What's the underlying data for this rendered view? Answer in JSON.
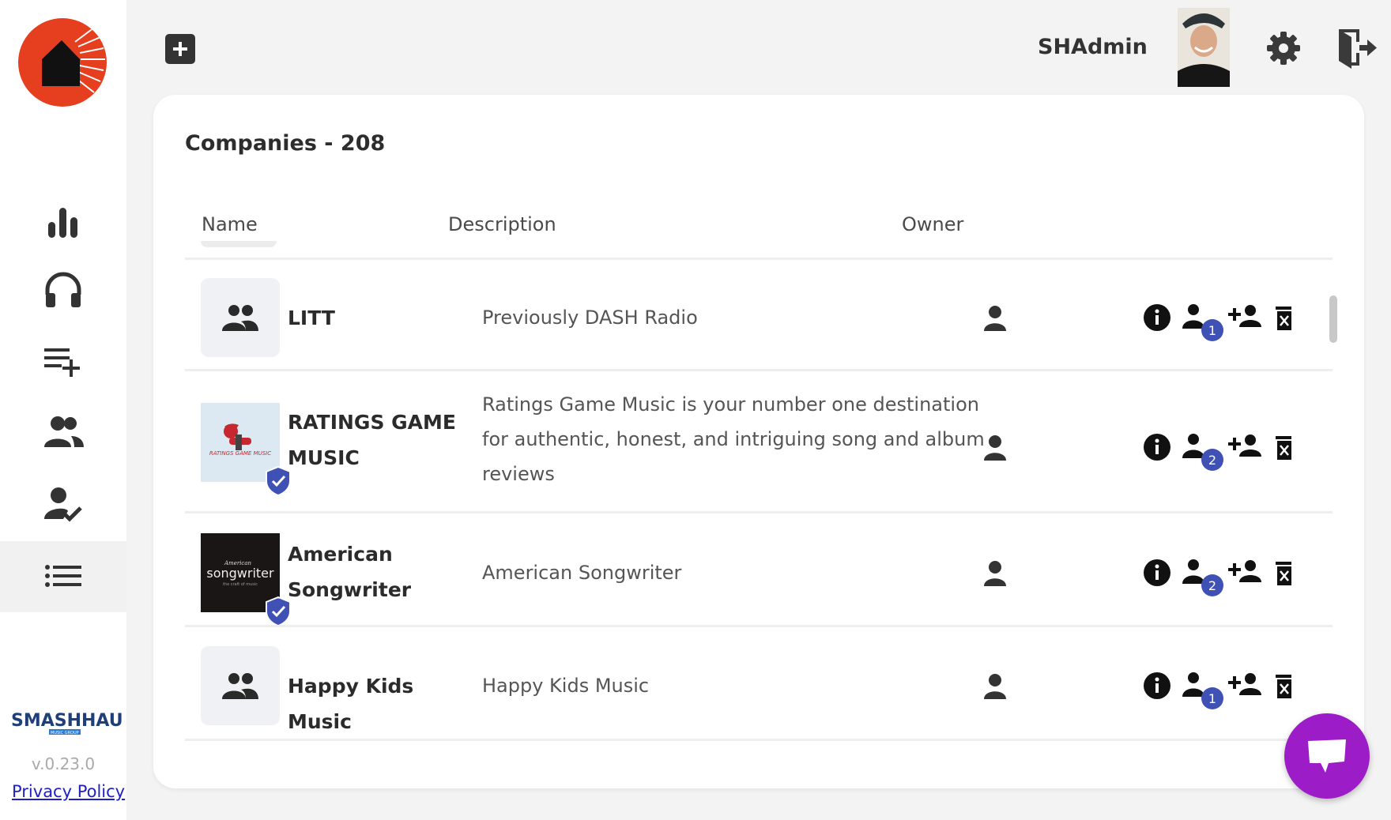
{
  "app": {
    "username": "SHAdmin",
    "version": "v.0.23.0",
    "privacy_label": "Privacy Policy",
    "brand_name": "SMASHHAUS",
    "brand_sub": "MUSIC GROUP"
  },
  "page": {
    "title": "Companies - 208"
  },
  "table": {
    "columns": {
      "name": "Name",
      "description": "Description",
      "owner": "Owner"
    },
    "rows": [
      {
        "name": "LITT",
        "description": "Previously DASH Radio",
        "members": "1",
        "verified": false
      },
      {
        "name": "RATINGS GAME MUSIC",
        "description": "Ratings Game Music is your number one destination for authentic, honest, and intriguing song and album reviews",
        "members": "2",
        "verified": true,
        "logo_text": "RATINGS GAME MUSIC"
      },
      {
        "name": "American Songwriter",
        "description": "American Songwriter",
        "members": "2",
        "verified": true,
        "logo_text": "songwriter",
        "logo_top": "American",
        "logo_sub": "the craft of music"
      },
      {
        "name": "Happy Kids Music",
        "description": "Happy Kids Music",
        "members": "1",
        "verified": false
      }
    ]
  },
  "colors": {
    "accent": "#3f51b5",
    "chat": "#9c1dc8",
    "logo": "#e63f1f"
  }
}
